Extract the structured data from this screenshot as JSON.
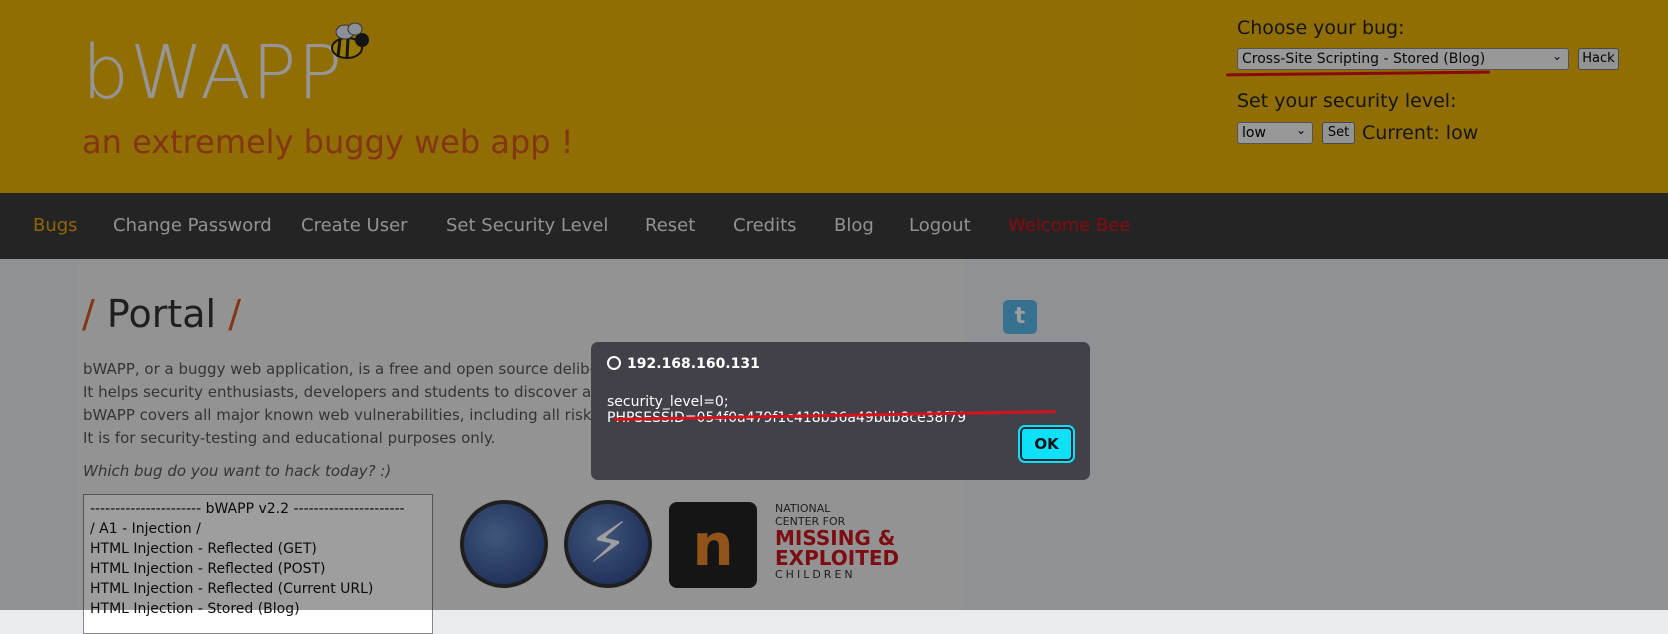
{
  "header": {
    "logo": "bWAPP",
    "tagline": "an extremely buggy web app !",
    "choose_label": "Choose your bug:",
    "bug_selected": "Cross-Site Scripting - Stored (Blog)",
    "hack_label": "Hack",
    "security_label": "Set your security level:",
    "level_selected": "low",
    "set_label": "Set",
    "current_level": "Current: low"
  },
  "nav": {
    "items": [
      "Bugs",
      "Change Password",
      "Create User",
      "Set Security Level",
      "Reset",
      "Credits",
      "Blog",
      "Logout",
      "Welcome Bee"
    ]
  },
  "main": {
    "title": "Portal",
    "desc": [
      "bWAPP, or a buggy web application, is a free and open source deliberately in",
      "It helps security enthusiasts, developers and students to discover and to prev",
      "bWAPP covers all major known web vulnerabilities, including all risks from th",
      "It is for security-testing and educational purposes only."
    ],
    "question": "Which bug do you want to hack today? :)",
    "bug_list": [
      "---------------------- bWAPP v2.2 ----------------------",
      "/ A1 - Injection /",
      "HTML Injection - Reflected (GET)",
      "HTML Injection - Reflected (POST)",
      "HTML Injection - Reflected (Current URL)",
      "HTML Injection - Stored (Blog)"
    ],
    "ncmec": {
      "line1": "NATIONAL",
      "line2": "CENTER FOR",
      "line3": "MISSING &",
      "line4": "EXPLOITED",
      "line5": "CHILDREN"
    }
  },
  "dialog": {
    "host": "192.168.160.131",
    "message": "security_level=0; PHPSESSID=054f0a479f1c418b36a49bdb8ce38f79",
    "ok_label": "OK"
  },
  "colors": {
    "header_bg": "#eab208",
    "nav_bg": "#3a3b3c",
    "accent": "#d2581f",
    "ok_button": "#0de0f7",
    "annotation": "#d9111b"
  }
}
